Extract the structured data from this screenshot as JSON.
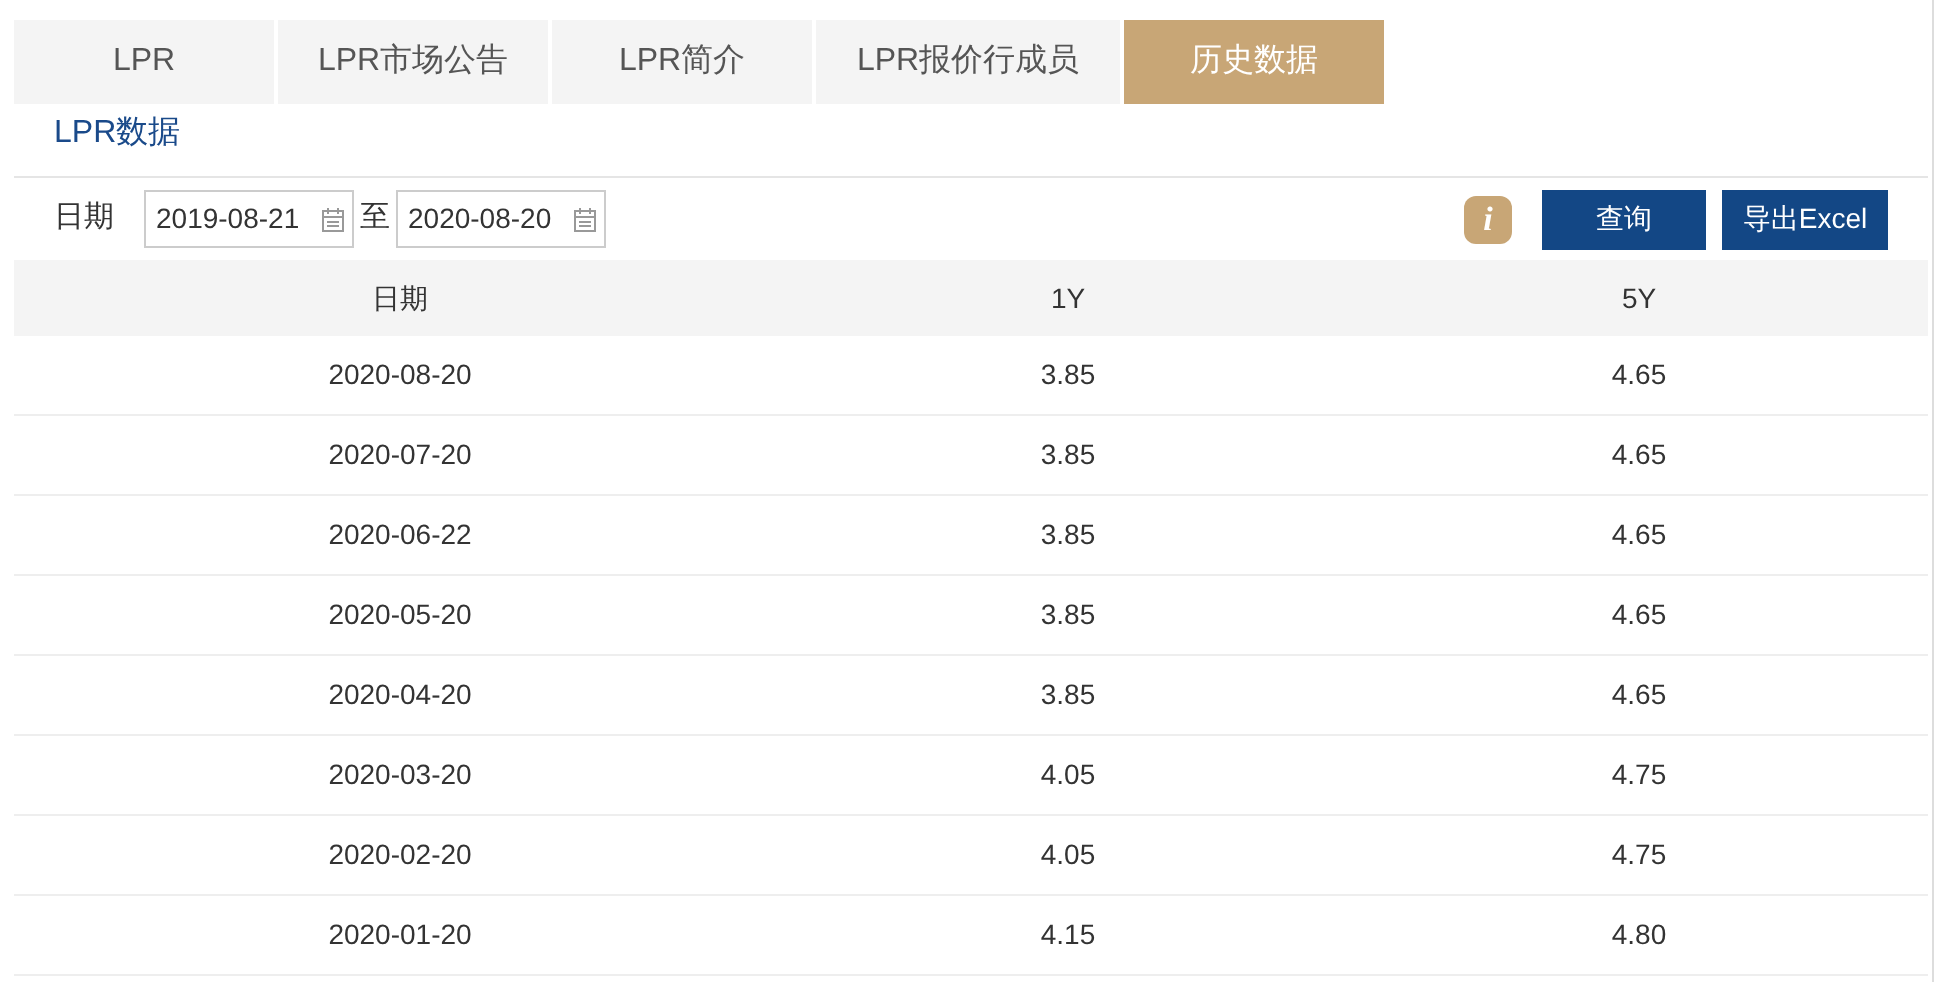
{
  "tabs": [
    {
      "label": "LPR",
      "selected": false
    },
    {
      "label": "LPR市场公告",
      "selected": false
    },
    {
      "label": "LPR简介",
      "selected": false
    },
    {
      "label": "LPR报价行成员",
      "selected": false
    },
    {
      "label": "历史数据",
      "selected": true
    }
  ],
  "section_title": "LPR数据",
  "filter": {
    "label": "日期",
    "start": "2019-08-21",
    "separator": "至",
    "end": "2020-08-20",
    "info_icon": "i",
    "buttons": [
      "查询",
      "导出Excel"
    ]
  },
  "table": {
    "columns": [
      "日期",
      "1Y",
      "5Y"
    ],
    "rows": [
      [
        "2020-08-20",
        "3.85",
        "4.65"
      ],
      [
        "2020-07-20",
        "3.85",
        "4.65"
      ],
      [
        "2020-06-22",
        "3.85",
        "4.65"
      ],
      [
        "2020-05-20",
        "3.85",
        "4.65"
      ],
      [
        "2020-04-20",
        "3.85",
        "4.65"
      ],
      [
        "2020-03-20",
        "4.05",
        "4.75"
      ],
      [
        "2020-02-20",
        "4.05",
        "4.75"
      ],
      [
        "2020-01-20",
        "4.15",
        "4.80"
      ]
    ]
  }
}
